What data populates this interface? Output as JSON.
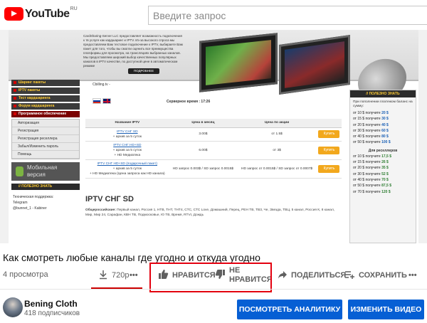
{
  "header": {
    "logo_text": "YouTube",
    "logo_region": "RU",
    "search_placeholder": "Введите запрос"
  },
  "site": {
    "banner_text": "CardSharing-Server LLC предоставляет возможность подключения к тв услуге как кардшаринг и IPTV. Из-за высокого спроса мы предоставляем Вам тестовое подключение к IPTV, выбираете Вам пакет для того, чтобы вы смогли оценить все преимущества платформы для просмотра, на трансляциях выбранных каналов. Мы предоставляем широкий выбор качественных популярных каналов в IPTV качестве, по доступной цене в автоматическом режиме",
    "banner_button": "ПОДРОБНЕЕ",
    "nav_items": [
      "Шаринг пакеты",
      "IPTV пакеты",
      "Тест кардшаринга",
      "Форум кардшаринга",
      "Программное обеспечение"
    ],
    "sub_items": [
      "Авторизация",
      "Регистрация",
      "Регистрация реселлера",
      "Забыл/Изменить пароль",
      "Помощь"
    ],
    "mobile_label": "Мобильная версия",
    "know_label": "// ПОЛЕЗНО ЗНАТЬ",
    "support_lines": [
      "Техническая поддержка:",
      "Telegram",
      "@bunnet_1 - Kabiner"
    ],
    "site_url": "Cbilling.tv -",
    "server_time": "Серверное время : 17:26",
    "table": {
      "headers": [
        "Название IPTV",
        "Цена в месяц",
        "Цена по акции",
        ""
      ],
      "rows": [
        {
          "name": "IPTV СНГ SD",
          "extra": [
            "+ архив за 5 суток"
          ],
          "price": "3.00$",
          "promo": "от 1.5$",
          "promo_link": "",
          "button": "Купить"
        },
        {
          "name": "IPTV СНГ HD+SD",
          "extra": [
            "+ архив за 5 суток",
            "+ HD Медиатека"
          ],
          "price": "6.00$",
          "promo": "от 3$",
          "promo_link": "",
          "button": "Купить"
        },
        {
          "name": "IPTV СНГ HD+SD (подарочный пакет)",
          "extra": [
            "+ архив за 5 суток",
            "+ HD Медиатека (Цена запроса как HD канала)"
          ],
          "price": "HD запрос 0.003$ / SD запрос 0.0015$",
          "promo": "HD запрос от 0.0015$ / SD запрос от 0.0007$",
          "promo_link": "",
          "button": "Купить"
        }
      ]
    },
    "iptv_title": "IPTV СНГ SD",
    "iptv_desc_label": "Общероссийские:",
    "iptv_desc": "Первый канал, Россия 1, НТВ, ТНТ, ТНТ4, СТС, СТС Love, Домашний, Перец, РЕН ТВ, ТВ3, Че, Звезда, ТВЦ, 5 канал, Россия К, 8 канал, Мир, Мир 24, Сарафан, КВН ТВ, Подмосковье, Ю ТВ, Время, RTVI, Дождь",
    "right_head": "// ПОЛЕЗНО ЗНАТЬ",
    "right_note": "При пополнении платежом баланс на сумму:",
    "bonus_rows": [
      {
        "from": "10 $",
        "get": "20 $"
      },
      {
        "from": "15 $",
        "get": "30 $"
      },
      {
        "from": "20 $",
        "get": "40 $"
      },
      {
        "from": "30 $",
        "get": "60 $"
      },
      {
        "from": "40 $",
        "get": "80 $"
      },
      {
        "from": "50 $",
        "get": "100 $"
      }
    ],
    "bonus_prefix": "получите",
    "right_sub": "Для реселлеров",
    "reseller_rows": [
      {
        "from": "10 $",
        "get": "17,5 $"
      },
      {
        "from": "15 $",
        "get": "26 $"
      },
      {
        "from": "20 $",
        "get": "35 $"
      },
      {
        "from": "30 $",
        "get": "52 $"
      },
      {
        "from": "40 $",
        "get": "70 $"
      },
      {
        "from": "50 $",
        "get": "87,5 $"
      },
      {
        "from": "70 $",
        "get": "120 $"
      }
    ]
  },
  "player": {
    "brightness_icon": "brightness-icon",
    "camera_icon": "camera-icon",
    "share_icon": "share-icon"
  },
  "video": {
    "title": "Как смотреть любые каналы где угодно и откуда угодно",
    "views": "4 просмотра",
    "quality": "720p",
    "more": "•••",
    "like": "НРАВИТСЯ",
    "dislike_line1": "НЕ",
    "dislike_line2": "НРАВИТСЯ",
    "share": "ПОДЕЛИТЬСЯ",
    "save": "СОХРАНИТЬ",
    "more2": "•••"
  },
  "channel": {
    "name": "Bening Cloth",
    "subscribers": "418 подписчиков",
    "analytics_button": "ПОСМОТРЕТЬ АНАЛИТИКУ",
    "edit_button": "ИЗМЕНИТЬ ВИДЕО"
  },
  "colors": {
    "accent_red": "#e3000f",
    "button_blue": "#065fd4",
    "youtube_red": "#ff0000"
  }
}
